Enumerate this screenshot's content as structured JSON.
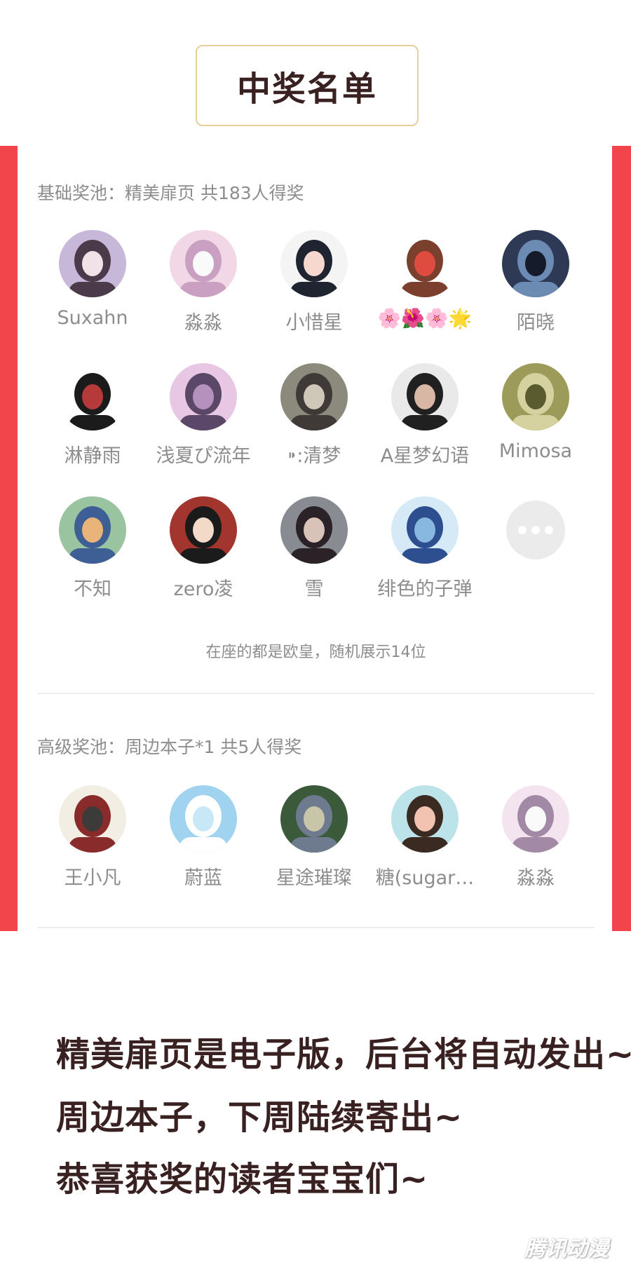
{
  "header": {
    "title": "中奖名单"
  },
  "basic_pool": {
    "heading": "基础奖池：精美扉页 共183人得奖",
    "winners": [
      {
        "name": "Suxahn",
        "colors": [
          "#c7b7d9",
          "#4a3a4a",
          "#f1e2e8"
        ]
      },
      {
        "name": "淼淼",
        "colors": [
          "#f2d7e6",
          "#c9a0c2",
          "#fafafa"
        ]
      },
      {
        "name": "小惜星",
        "colors": [
          "#f4f4f4",
          "#1f2530",
          "#f6d8cf"
        ]
      },
      {
        "name": "🌸🌺🌸🌟",
        "colors": [
          "#ffffff",
          "#7b3f2e",
          "#e04b3f"
        ]
      },
      {
        "name": "陌晓",
        "colors": [
          "#2e3a55",
          "#6c8bb2",
          "#151b2b"
        ]
      },
      {
        "name": "淋静雨",
        "colors": [
          "#ffffff",
          "#1b1b1b",
          "#b73a3a"
        ]
      },
      {
        "name": "浅夏ぴ流年",
        "colors": [
          "#e7c7e3",
          "#5b4868",
          "#b592be"
        ]
      },
      {
        "name": "⁍:清梦",
        "colors": [
          "#8c8a7c",
          "#3f3a38",
          "#cfc7b8"
        ]
      },
      {
        "name": "A星梦幻语",
        "colors": [
          "#e9e9e9",
          "#202020",
          "#d8b8a4"
        ]
      },
      {
        "name": "Mimosa",
        "colors": [
          "#9c9b59",
          "#d6d2a0",
          "#5a5c2f"
        ]
      },
      {
        "name": "不知",
        "colors": [
          "#9ac3a0",
          "#3d5f96",
          "#e8b47a"
        ]
      },
      {
        "name": "zero凌",
        "colors": [
          "#a3352f",
          "#1b1b1b",
          "#f3d9c8"
        ]
      },
      {
        "name": "雪",
        "colors": [
          "#888b92",
          "#2a2226",
          "#d9c3b9"
        ]
      },
      {
        "name": "绯色的子弹",
        "colors": [
          "#d5e9f7",
          "#2e4f8f",
          "#88b7e0"
        ]
      }
    ],
    "more_icon": "more-dots-icon",
    "note": "在座的都是欧皇，随机展示14位"
  },
  "advanced_pool": {
    "heading": "高级奖池：周边本子*1 共5人得奖",
    "winners": [
      {
        "name": "王小凡",
        "colors": [
          "#f2eee4",
          "#8a2b2b",
          "#3d3a3a"
        ]
      },
      {
        "name": "蔚蓝",
        "colors": [
          "#9fd3ef",
          "#ffffff",
          "#c8e8f8"
        ]
      },
      {
        "name": "星途璀璨",
        "colors": [
          "#3b5a3a",
          "#6e7b8f",
          "#c9c5a8"
        ]
      },
      {
        "name": "糖(sugar…",
        "colors": [
          "#bde3ea",
          "#3a2a22",
          "#f3c3b2"
        ]
      },
      {
        "name": "淼淼",
        "colors": [
          "#f4e4ef",
          "#a28aa6",
          "#fafafa"
        ]
      }
    ]
  },
  "closing": {
    "line1": "精美扉页是电子版，后台将自动发出~",
    "line2": "周边本子，下周陆续寄出~",
    "line3": "恭喜获奖的读者宝宝们~"
  },
  "watermark": "腾讯动漫",
  "theme": {
    "accent": "#f2454b",
    "title_border": "#e6cf9a",
    "title_color": "#3a2121",
    "muted_text": "#8d8d8d"
  }
}
